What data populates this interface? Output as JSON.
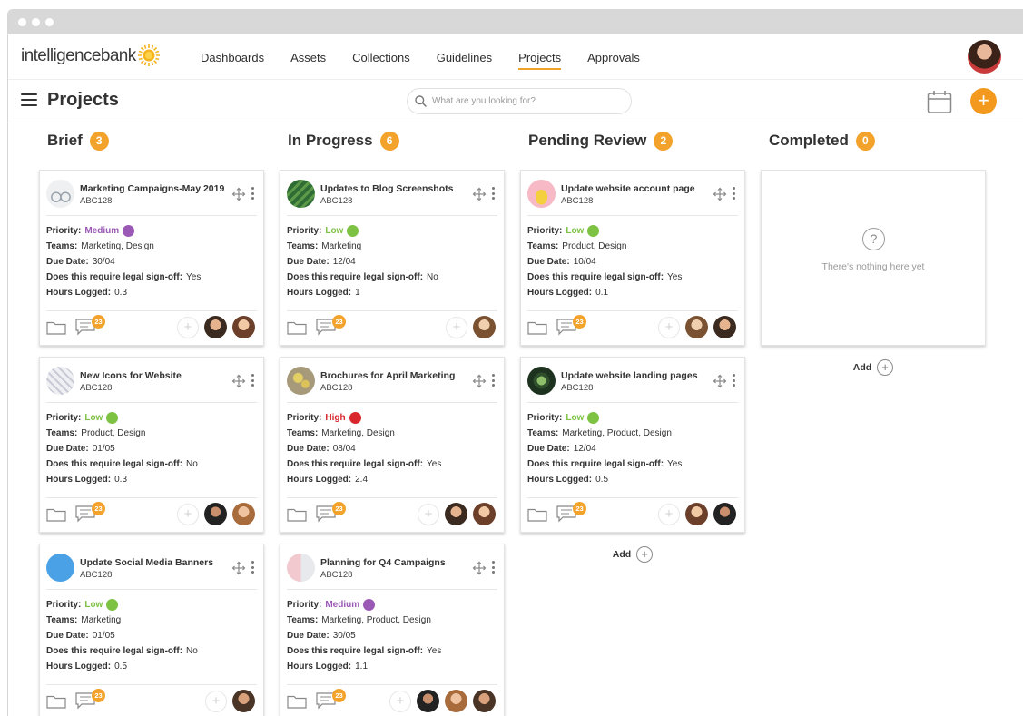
{
  "nav": {
    "logo_text": "intelligencebank",
    "links": [
      "Dashboards",
      "Assets",
      "Collections",
      "Guidelines",
      "Projects",
      "Approvals"
    ],
    "active": "Projects"
  },
  "toolbar": {
    "title": "Projects",
    "search_placeholder": "What are you looking for?",
    "add_label": "+"
  },
  "labels": {
    "priority": "Priority:",
    "teams": "Teams:",
    "due_date": "Due Date:",
    "legal": "Does this require legal sign-off:",
    "hours": "Hours Logged:",
    "add": "Add",
    "empty": "There's nothing here yet",
    "comment_count": "23"
  },
  "colors": {
    "accent": "#f3a32b",
    "priority_low": "#7dc242",
    "priority_medium": "#9b59b6",
    "priority_high": "#d9262c"
  },
  "columns": [
    {
      "title": "Brief",
      "count": "3",
      "cards": [
        {
          "title": "Marketing Campaigns-May 2019",
          "code": "ABC128",
          "thumb": "bike-thumb",
          "priority": "Medium",
          "teams": "Marketing, Design",
          "due": "30/04",
          "legal": "Yes",
          "hours": "0.3",
          "assignees": 2
        },
        {
          "title": "New Icons for Website",
          "code": "ABC128",
          "thumb": "pattern-thumb",
          "priority": "Low",
          "teams": "Product, Design",
          "due": "01/05",
          "legal": "No",
          "hours": "0.3",
          "assignees": 2
        },
        {
          "title": "Update Social Media Banners",
          "code": "ABC128",
          "thumb": "twitter-thumb",
          "priority": "Low",
          "teams": "Marketing",
          "due": "01/05",
          "legal": "No",
          "hours": "0.5",
          "assignees": 1
        }
      ]
    },
    {
      "title": "In Progress",
      "count": "6",
      "cards": [
        {
          "title": "Updates to Blog Screenshots",
          "code": "ABC128",
          "thumb": "leaf-thumb",
          "priority": "Low",
          "teams": "Marketing",
          "due": "12/04",
          "legal": "No",
          "hours": "1",
          "assignees": 1
        },
        {
          "title": "Brochures for April Marketing",
          "code": "ABC128",
          "thumb": "flower-thumb",
          "priority": "High",
          "teams": "Marketing, Design",
          "due": "08/04",
          "legal": "Yes",
          "hours": "2.4",
          "assignees": 2
        },
        {
          "title": "Planning for Q4 Campaigns",
          "code": "ABC128",
          "thumb": "shapes-thumb",
          "priority": "Medium",
          "teams": "Marketing, Product, Design",
          "due": "30/05",
          "legal": "Yes",
          "hours": "1.1",
          "assignees": 3
        }
      ]
    },
    {
      "title": "Pending Review",
      "count": "2",
      "cards": [
        {
          "title": "Update website account page",
          "code": "ABC128",
          "thumb": "banana-thumb",
          "priority": "Low",
          "teams": "Product, Design",
          "due": "10/04",
          "legal": "Yes",
          "hours": "0.1",
          "assignees": 2
        },
        {
          "title": "Update website landing pages",
          "code": "ABC128",
          "thumb": "plant-thumb",
          "priority": "Low",
          "teams": "Marketing, Product, Design",
          "due": "12/04",
          "legal": "Yes",
          "hours": "0.5",
          "assignees": 2
        }
      ]
    },
    {
      "title": "Completed",
      "count": "0",
      "cards": []
    }
  ]
}
